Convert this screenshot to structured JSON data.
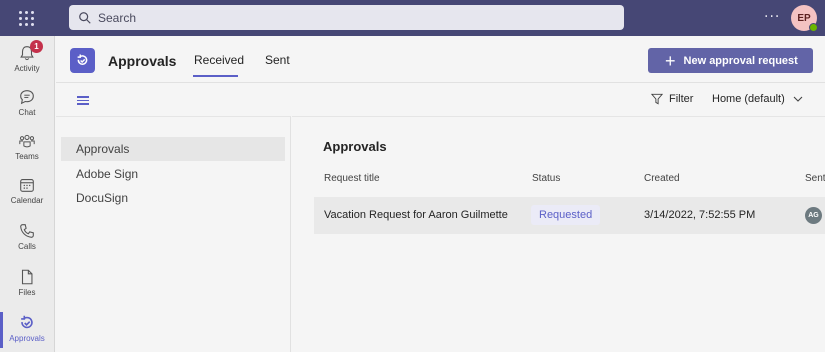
{
  "topbar": {
    "search_placeholder": "Search",
    "more_label": "···",
    "user_initials": "EP"
  },
  "rail": {
    "items": [
      {
        "label": "Activity",
        "icon": "bell-icon",
        "badge": "1"
      },
      {
        "label": "Chat",
        "icon": "chat-icon"
      },
      {
        "label": "Teams",
        "icon": "teams-icon"
      },
      {
        "label": "Calendar",
        "icon": "calendar-icon"
      },
      {
        "label": "Calls",
        "icon": "phone-icon"
      },
      {
        "label": "Files",
        "icon": "file-icon"
      },
      {
        "label": "Approvals",
        "icon": "approvals-icon",
        "active": true
      }
    ]
  },
  "app": {
    "title": "Approvals",
    "tabs": [
      {
        "label": "Received",
        "active": true
      },
      {
        "label": "Sent"
      }
    ],
    "new_button_label": "New approval request",
    "accent_color": "#6264a7"
  },
  "toolbar": {
    "filter_label": "Filter",
    "view_label": "Home (default)"
  },
  "sidebar": {
    "items": [
      {
        "label": "Approvals",
        "selected": true
      },
      {
        "label": "Adobe Sign"
      },
      {
        "label": "DocuSign"
      }
    ]
  },
  "main": {
    "title": "Approvals",
    "columns": [
      "Request title",
      "Status",
      "Created",
      "Sent"
    ],
    "rows": [
      {
        "title": "Vacation Request for Aaron Guilmette",
        "status": "Requested",
        "created": "3/14/2022, 7:52:55 PM",
        "sender_initials": "AG"
      }
    ]
  }
}
